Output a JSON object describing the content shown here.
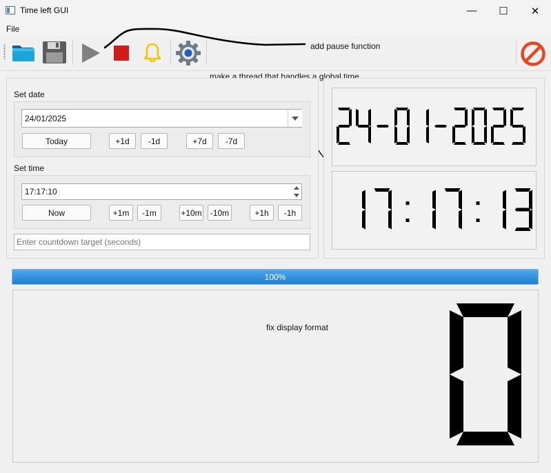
{
  "window": {
    "title": "Time left GUI",
    "minimize": "—",
    "maximize": "☐",
    "close": "✕"
  },
  "menu": {
    "file": "File"
  },
  "toolbar": {
    "icons": [
      "folder-open-icon",
      "save-icon",
      "play-icon",
      "stop-icon",
      "bell-icon",
      "gear-icon",
      "cancel-icon"
    ]
  },
  "annotations": {
    "pause": "add pause function",
    "thread": "make a thread that handles a global time",
    "format": "fix display format"
  },
  "set_date": {
    "title": "Set date",
    "value": "24/01/2025",
    "today": "Today",
    "plus1d": "+1d",
    "minus1d": "-1d",
    "plus7d": "+7d",
    "minus7d": "-7d"
  },
  "set_time": {
    "title": "Set time",
    "value": "17:17:10",
    "now": "Now",
    "plus1m": "+1m",
    "minus1m": "-1m",
    "plus10m": "+10m",
    "minus10m": "-10m",
    "plus1h": "+1h",
    "minus1h": "-1h"
  },
  "countdown": {
    "placeholder": "Enter countdown target (seconds)"
  },
  "lcd": {
    "date": "24-01-2025",
    "time": "17:17:13",
    "big": "0"
  },
  "progress": {
    "value": 1.0,
    "text": "100%"
  },
  "colors": {
    "accent": "#2b8ad6",
    "stop": "#d01c1c",
    "bell": "#f4c400",
    "cancel": "#e8461e"
  }
}
